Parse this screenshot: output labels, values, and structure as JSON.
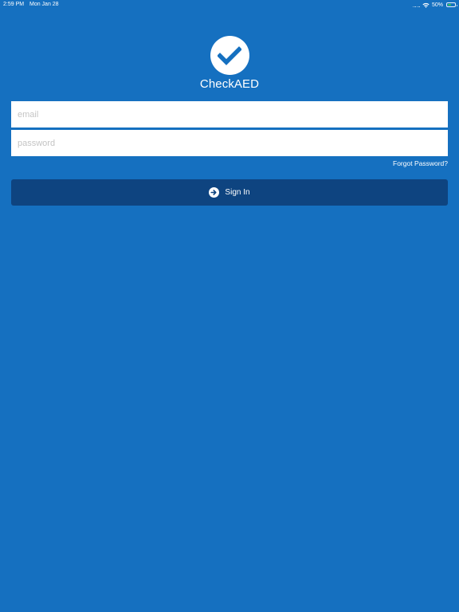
{
  "status_bar": {
    "time": "2:59 PM",
    "date": "Mon Jan 28",
    "battery_percent": "50%",
    "battery_level": 0.5,
    "icons": [
      "signal-dots-icon",
      "wifi-icon",
      "battery-icon"
    ]
  },
  "app": {
    "name": "CheckAED",
    "logo_icon": "checkmark-icon"
  },
  "login": {
    "email_placeholder": "email",
    "password_placeholder": "password",
    "forgot_password": "Forgot Password?",
    "sign_in_label": "Sign In",
    "sign_in_icon": "arrow-right-circle-icon"
  },
  "colors": {
    "background": "#1570C0",
    "button": "#0E4480",
    "field": "#FFFFFF",
    "text": "#FFFFFF",
    "placeholder": "#C4C4C4",
    "battery": "#34C759"
  }
}
